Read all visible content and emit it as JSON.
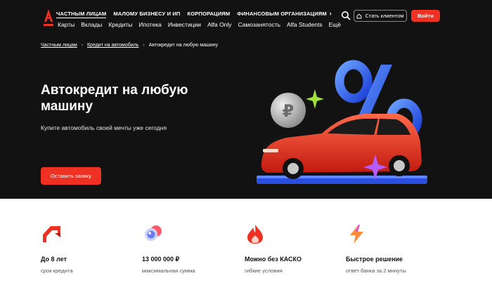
{
  "header": {
    "segments": [
      "ЧАСТНЫМ ЛИЦАМ",
      "МАЛОМУ БИЗНЕСУ И ИП",
      "КОРПОРАЦИЯМ",
      "ФИНАНСОВЫМ ОРГАНИЗАЦИЯМ"
    ],
    "nav": [
      "Карты",
      "Вклады",
      "Кредиты",
      "Ипотека",
      "Инвестиции",
      "Alfa Only",
      "Самозанятость",
      "Alfa Students",
      "Ещё"
    ],
    "client_button": "Стать клиентом",
    "login_button": "Войти",
    "brand_color": "#ef3124"
  },
  "breadcrumbs": [
    "Частным лицам",
    "Кредит на автомобиль",
    "Автокредит на любую машину"
  ],
  "hero": {
    "title": "Автокредит на любую машину",
    "subtitle": "Купите автомобиль своей мечты уже сегодня",
    "cta": "Оставить заявку"
  },
  "features": [
    {
      "icon": "arrow-icon",
      "title": "До 8 лет",
      "desc": "срок кредита"
    },
    {
      "icon": "coins-icon",
      "title": "13 000 000 ₽",
      "desc": "максимальная сумма"
    },
    {
      "icon": "flame-icon",
      "title": "Можно без КАСКО",
      "desc": "гибкие условия"
    },
    {
      "icon": "lightning-icon",
      "title": "Быстрое решение",
      "desc": "ответ банка за 2 минуты"
    }
  ]
}
